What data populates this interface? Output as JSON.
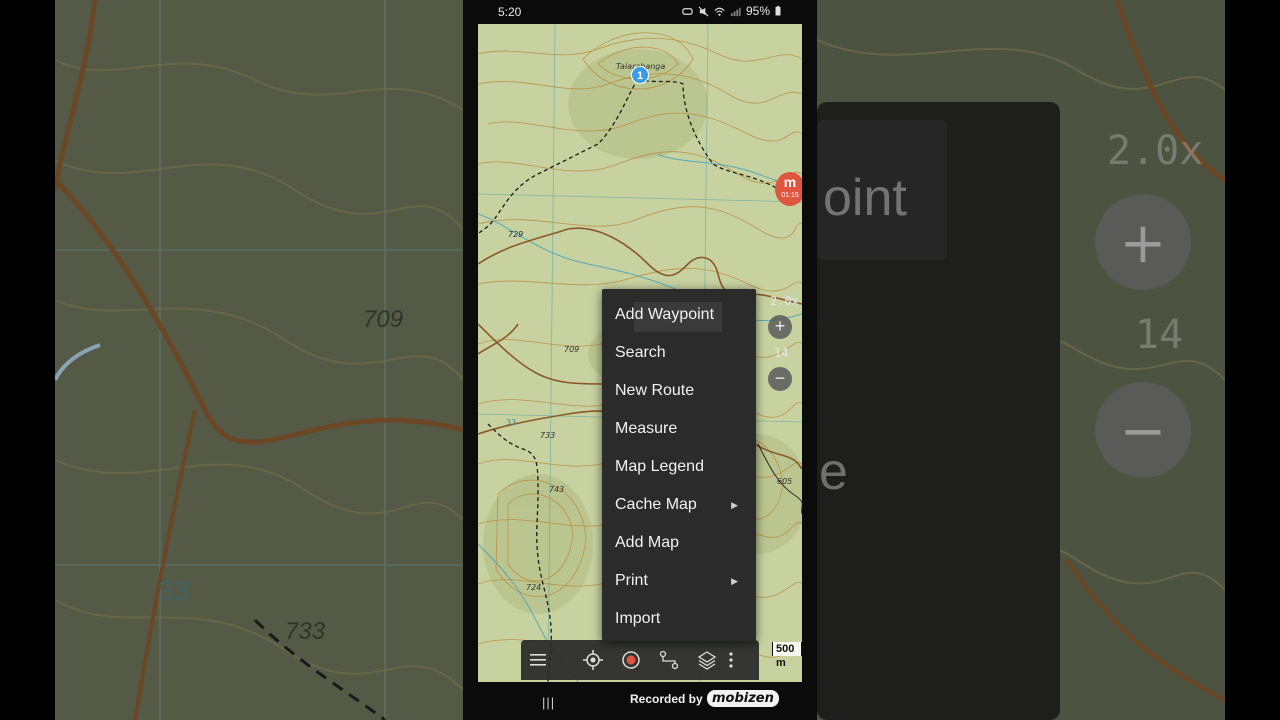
{
  "status_bar": {
    "time": "5:20",
    "battery": "95%",
    "icons": [
      "vr-icon",
      "mute-icon",
      "wifi-icon",
      "signal-icon",
      "battery-icon"
    ]
  },
  "map": {
    "waypoint_number": "1",
    "peak_name": "Taiarahanga",
    "labels": {
      "elev_729": "729",
      "elev_709": "709",
      "elev_733": "733",
      "elev_743": "743",
      "elev_724": "724",
      "elev_605": "605",
      "grid_33": "33"
    },
    "zoom_factor": "2.0x",
    "zoom_level": "14",
    "scale": "500 m",
    "track_marker_time": "01:15"
  },
  "context_menu": {
    "items": [
      {
        "label": "Add Waypoint",
        "submenu": false
      },
      {
        "label": "Search",
        "submenu": false
      },
      {
        "label": "New Route",
        "submenu": false
      },
      {
        "label": "Measure",
        "submenu": false
      },
      {
        "label": "Map Legend",
        "submenu": false
      },
      {
        "label": "Cache Map",
        "submenu": true
      },
      {
        "label": "Add Map",
        "submenu": false
      },
      {
        "label": "Print",
        "submenu": true
      },
      {
        "label": "Import",
        "submenu": false
      }
    ]
  },
  "toolbar": {
    "buttons": [
      "menu-icon",
      "locate-icon",
      "record-icon",
      "route-icon",
      "layers-icon",
      "more-icon"
    ]
  },
  "navbar": {
    "recents": "|||",
    "recorded_by": "Recorded by",
    "recorder_brand": "mobizen"
  },
  "background": {
    "left_elev_709": "709",
    "left_elev_733": "733",
    "left_grid_33": "33",
    "right_zoom_factor": "2.0x",
    "right_zoom_level": "14",
    "right_menu_fragment": "oint",
    "right_menu_fragment2": "e"
  },
  "colors": {
    "map_base": "#c9d3a3",
    "contour": "#b8893a",
    "road": "#8a5a2a",
    "menu_bg": "#2b2b2b",
    "waypoint": "#3a9ae8",
    "track_marker": "#e0553f"
  }
}
